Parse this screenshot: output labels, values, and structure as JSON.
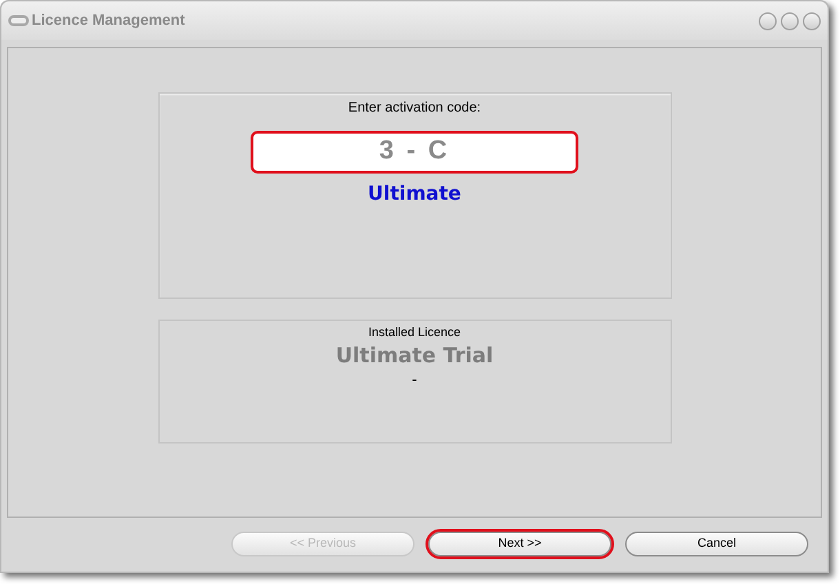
{
  "window": {
    "title": "Licence Management"
  },
  "activation": {
    "label": "Enter activation code:",
    "value": "3 - C",
    "highlighted": true,
    "edition": "Ultimate"
  },
  "installed": {
    "label": "Installed Licence",
    "edition": "Ultimate Trial",
    "detail": "-"
  },
  "buttons": [
    {
      "label": "<< Previous",
      "disabled": true,
      "highlighted": false
    },
    {
      "label": "Next >>",
      "disabled": false,
      "highlighted": true
    },
    {
      "label": "Cancel",
      "disabled": false,
      "highlighted": false
    }
  ]
}
